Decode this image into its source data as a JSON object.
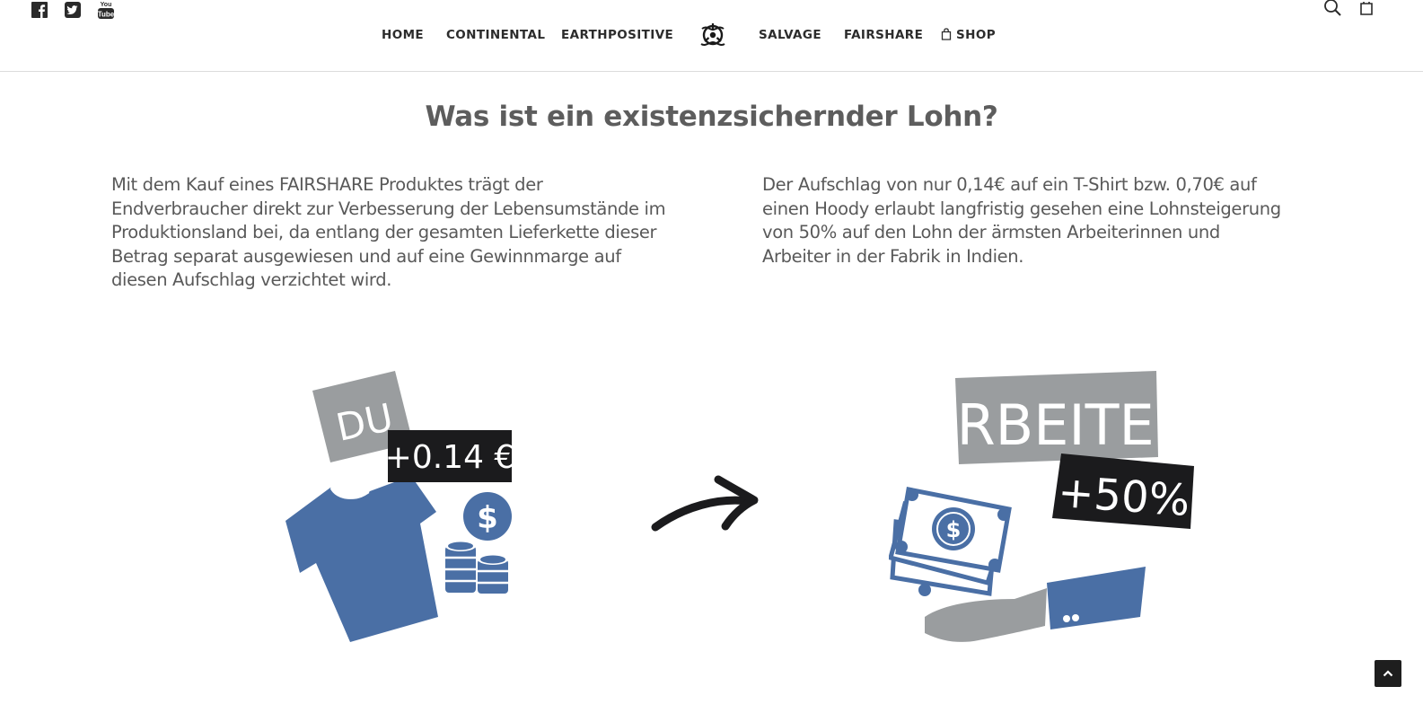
{
  "social": [
    {
      "name": "facebook-icon"
    },
    {
      "name": "twitter-icon"
    },
    {
      "name": "youtube-icon",
      "text": "You Tube"
    }
  ],
  "nav": {
    "home": "HOME",
    "continental": "CONTINENTAL",
    "earthpositive": "EARTHPOSITIVE",
    "salvage": "SALVAGE",
    "fairshare": "FAIRSHARE",
    "shop": "SHOP"
  },
  "main": {
    "heading": "Was ist ein existenzsichernder Lohn?",
    "left_text": "Mit dem Kauf eines FAIRSHARE Produktes trägt der Endverbraucher direkt zur Verbesserung der Lebensumstände im Produktionsland bei, da entlang der gesamten Lieferkette dieser Betrag separat ausgewiesen und auf eine Gewinnmarge auf diesen Aufschlag verzichtet wird.",
    "right_text": "Der Aufschlag von nur 0,14€ auf ein T-Shirt bzw. 0,70€ auf einen Hoody erlaubt langfristig gesehen eine Lohnsteigerung von 50% auf den Lohn der ärmsten Arbeiterinnen und Arbeiter in der Fabrik in Indien."
  },
  "illustration": {
    "du_label": "DU",
    "price_label": "+0.14 €",
    "arbeiter_label": "ARBEITER",
    "percent_label": "+50%",
    "dollar_symbol": "$"
  },
  "colors": {
    "blue": "#4a6fa5",
    "gray": "#9a9d9f",
    "dark": "#1b1b1d"
  }
}
